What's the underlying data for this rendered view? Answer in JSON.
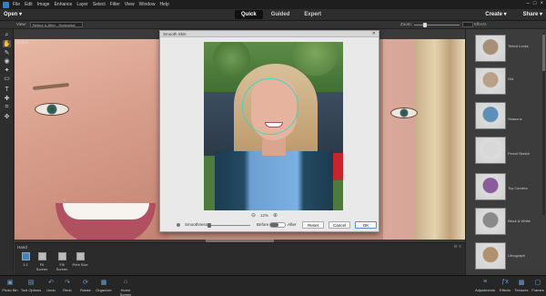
{
  "menubar": {
    "items": [
      "File",
      "Edit",
      "Image",
      "Enhance",
      "Layer",
      "Select",
      "Filter",
      "View",
      "Window",
      "Help"
    ],
    "window_controls": [
      "–",
      "□",
      "×"
    ]
  },
  "topbar": {
    "open": "Open",
    "modes": [
      "Quick",
      "Guided",
      "Expert"
    ],
    "create": "Create",
    "share": "Share"
  },
  "options": {
    "view_label": "View:",
    "view_value": "Before & After - Horizontal",
    "zoom_label": "Zoom:",
    "zoom_value": "",
    "panel_title": "Effects"
  },
  "canvas": {
    "before_label": "Before"
  },
  "dialog": {
    "title": "Smooth Skin",
    "zoom_value": "12%",
    "smoothness_label": "Smoothness:",
    "smoothness_level": 0,
    "before_label": "Before",
    "after_label": "After",
    "buttons": {
      "reset": "Reset",
      "cancel": "Cancel",
      "ok": "OK"
    }
  },
  "bottom_panel": {
    "title": "Hand",
    "items": [
      {
        "label": "1:1"
      },
      {
        "label": "Fit Screen"
      },
      {
        "label": "Fill Screen"
      },
      {
        "label": "Print Size"
      }
    ]
  },
  "effects": [
    {
      "label": "Tinted Looks",
      "color": "#a88f77"
    },
    {
      "label": "Old",
      "color": "#b9a089"
    },
    {
      "label": "Seasons",
      "color": "#5f8fb8"
    },
    {
      "label": "Pencil Sketch",
      "color": "#d8d8d8"
    },
    {
      "label": "Toy Camera",
      "color": "#8b5c9c"
    },
    {
      "label": "Black & White",
      "color": "#8a8a8a"
    },
    {
      "label": "Lithograph",
      "color": "#b29170"
    }
  ],
  "footer": {
    "left": [
      {
        "label": "Photo Bin",
        "icon": "photo-bin-icon"
      },
      {
        "label": "Tool Options",
        "icon": "tool-options-icon"
      },
      {
        "label": "Undo",
        "icon": "undo-icon"
      },
      {
        "label": "Redo",
        "icon": "redo-icon"
      },
      {
        "label": "Rotate",
        "icon": "rotate-icon"
      },
      {
        "label": "Organizer",
        "icon": "organizer-icon"
      },
      {
        "label": "Home Screen",
        "icon": "home-icon"
      }
    ],
    "right": [
      {
        "label": "Adjustments",
        "icon": "adjustments-icon"
      },
      {
        "label": "Effects",
        "icon": "effects-icon"
      },
      {
        "label": "Textures",
        "icon": "textures-icon"
      },
      {
        "label": "Frames",
        "icon": "frames-icon"
      }
    ]
  }
}
